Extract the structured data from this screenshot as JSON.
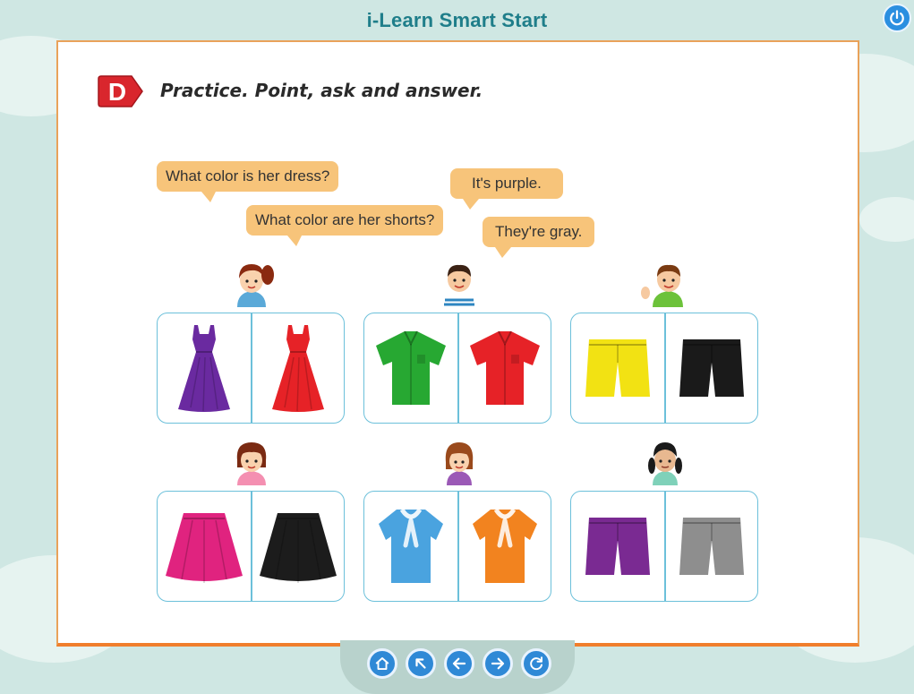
{
  "app": {
    "title": "i-Learn Smart Start"
  },
  "section": {
    "letter": "D",
    "instruction": "Practice. Point, ask and answer."
  },
  "bubbles": {
    "q1": "What color is her dress?",
    "q2": "What color are her shorts?",
    "a1": "It's purple.",
    "a2": "They're gray."
  },
  "colors": {
    "accent": "#f07e2c",
    "badge": "#d9262d",
    "bubble": "#f7c47a",
    "card_border": "#6cc0da",
    "nav_button": "#2f89d6"
  },
  "cards": [
    {
      "kid": "girl-ponytail-icon",
      "items": [
        {
          "icon": "dress-icon",
          "color": "#6a2aa0"
        },
        {
          "icon": "dress-icon",
          "color": "#e62227"
        }
      ]
    },
    {
      "kid": "boy-striped-shirt-icon",
      "items": [
        {
          "icon": "shirt-icon",
          "color": "#27a832"
        },
        {
          "icon": "shirt-icon",
          "color": "#e62227"
        }
      ]
    },
    {
      "kid": "boy-waving-icon",
      "items": [
        {
          "icon": "shorts-icon",
          "color": "#f2e213"
        },
        {
          "icon": "shorts-icon",
          "color": "#1a1a1a"
        }
      ]
    },
    {
      "kid": "girl-short-hair-icon",
      "items": [
        {
          "icon": "skirt-icon",
          "color": "#e0237f"
        },
        {
          "icon": "skirt-icon",
          "color": "#1c1c1c"
        }
      ]
    },
    {
      "kid": "girl-bob-icon",
      "items": [
        {
          "icon": "blouse-icon",
          "color": "#4aa3df"
        },
        {
          "icon": "blouse-icon",
          "color": "#f2831f"
        }
      ]
    },
    {
      "kid": "girl-braids-icon",
      "items": [
        {
          "icon": "shorts-icon",
          "color": "#7a2a92"
        },
        {
          "icon": "shorts-icon",
          "color": "#8e8e8e"
        }
      ]
    }
  ],
  "nav": [
    {
      "icon": "home-icon"
    },
    {
      "icon": "arrow-up-left-icon"
    },
    {
      "icon": "arrow-left-icon"
    },
    {
      "icon": "arrow-right-icon"
    },
    {
      "icon": "refresh-icon"
    }
  ]
}
